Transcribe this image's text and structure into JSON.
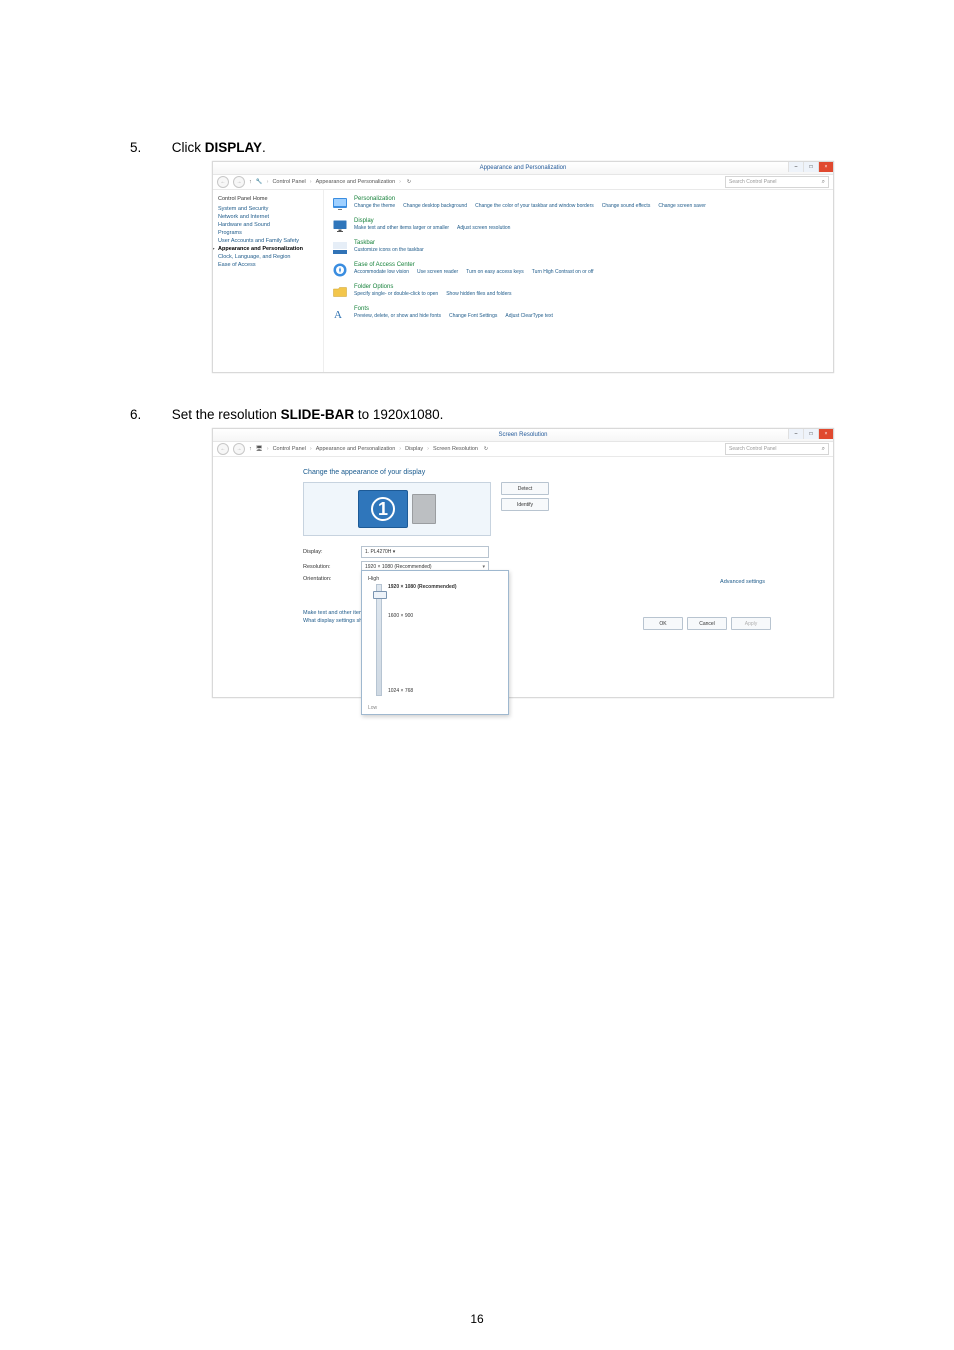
{
  "page_number": "16",
  "steps": {
    "s5": {
      "num": "5.",
      "pre": "Click ",
      "bold": "DISPLAY",
      "post": "."
    },
    "s6": {
      "num": "6.",
      "pre": "Set the resolution ",
      "bold": "SLIDE-BAR",
      "post": " to 1920x1080."
    }
  },
  "shot1": {
    "title": "Appearance and Personalization",
    "breadcrumb": [
      "Control Panel",
      "Appearance and Personalization"
    ],
    "search_placeholder": "Search Control Panel",
    "sidebar_header": "Control Panel Home",
    "sidebar": [
      "System and Security",
      "Network and Internet",
      "Hardware and Sound",
      "Programs",
      "User Accounts and Family Safety",
      "Appearance and Personalization",
      "Clock, Language, and Region",
      "Ease of Access"
    ],
    "sidebar_selected_index": 5,
    "categories": [
      {
        "icon": "personalization",
        "heading": "Personalization",
        "links": [
          "Change the theme",
          "Change desktop background",
          "Change the color of your taskbar and window borders",
          "Change sound effects",
          "Change screen saver"
        ]
      },
      {
        "icon": "display",
        "heading": "Display",
        "links": [
          "Make text and other items larger or smaller",
          "Adjust screen resolution"
        ]
      },
      {
        "icon": "taskbar",
        "heading": "Taskbar",
        "links": [
          "Customize icons on the taskbar"
        ]
      },
      {
        "icon": "ease",
        "heading": "Ease of Access Center",
        "links": [
          "Accommodate low vision",
          "Use screen reader",
          "Turn on easy access keys",
          "Turn High Contrast on or off"
        ]
      },
      {
        "icon": "folder",
        "heading": "Folder Options",
        "links": [
          "Specify single- or double-click to open",
          "Show hidden files and folders"
        ]
      },
      {
        "icon": "fonts",
        "heading": "Fonts",
        "links": [
          "Preview, delete, or show and hide fonts",
          "Change Font Settings",
          "Adjust ClearType text"
        ]
      }
    ]
  },
  "shot2": {
    "title": "Screen Resolution",
    "breadcrumb": [
      "Control Panel",
      "Appearance and Personalization",
      "Display",
      "Screen Resolution"
    ],
    "search_placeholder": "Search Control Panel",
    "heading": "Change the appearance of your display",
    "monitor_number": "1",
    "buttons": {
      "detect": "Detect",
      "identify": "Identify"
    },
    "fields": {
      "display_label": "Display:",
      "display_value": "1. PL4270H ▾",
      "resolution_label": "Resolution:",
      "resolution_value": "1920 × 1080 (Recommended)",
      "orientation_label": "Orientation:"
    },
    "dropdown": {
      "high": "High",
      "options": [
        "1920 × 1080 (Recommended)",
        "1600 × 900",
        "",
        "",
        "1024 × 768"
      ],
      "low": "Low"
    },
    "links": [
      "Make text and other items larger or smaller",
      "What display settings should I choose?"
    ],
    "advanced": "Advanced settings",
    "dlg": {
      "ok": "OK",
      "cancel": "Cancel",
      "apply": "Apply"
    }
  }
}
